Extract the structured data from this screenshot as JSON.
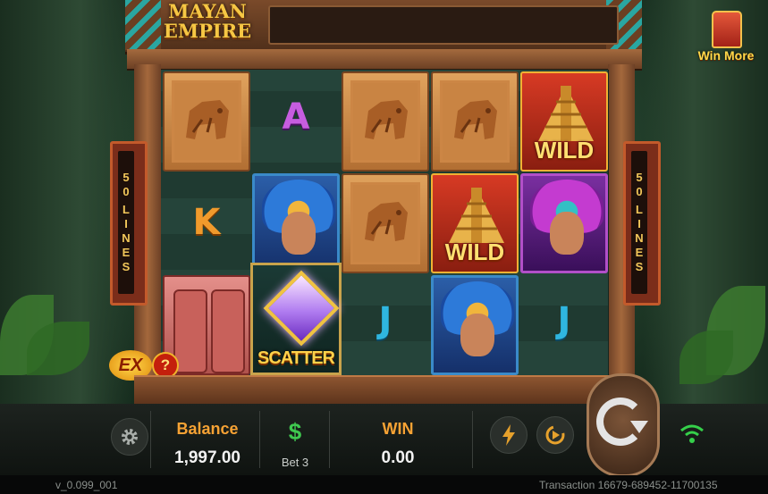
{
  "game": {
    "logo_line1": "MAYAN",
    "logo_line2": "EMPIRE",
    "win_more_label": "Win More"
  },
  "paylines": {
    "left_label": [
      "5",
      "0",
      "L",
      "I",
      "N",
      "E",
      "S"
    ],
    "right_label": [
      "5",
      "0",
      "L",
      "I",
      "N",
      "E",
      "S"
    ]
  },
  "reels": [
    [
      "jaguar-stone",
      "letter-k",
      "totem-stone"
    ],
    [
      "letter-a",
      "warrior",
      "scatter"
    ],
    [
      "jaguar-stone",
      "jaguar-stone",
      "letter-j"
    ],
    [
      "jaguar-stone",
      "wild",
      "warrior"
    ],
    [
      "wild",
      "priestess",
      "letter-j"
    ]
  ],
  "symbols": {
    "letter_a": "A",
    "letter_k": "K",
    "letter_j": "J",
    "wild": "WILD",
    "scatter": "SCATTER"
  },
  "extra_bet": {
    "label": "EX",
    "help": "?"
  },
  "hud": {
    "balance_label": "Balance",
    "balance_value": "1,997.00",
    "bet_icon": "$",
    "bet_label": "Bet 3",
    "win_label": "WIN",
    "win_value": "0.00"
  },
  "icons": {
    "settings": "gear-icon",
    "turbo": "lightning-icon",
    "autoplay": "autoplay-icon",
    "spin": "spin-icon",
    "signal": "wifi-icon",
    "chest": "treasure-chest-icon"
  },
  "footer": {
    "version": "v_0.099_001",
    "transaction": "Transaction 16679-689452-11700135"
  },
  "colors": {
    "gold_text": "#f6a234",
    "win_text": "#f6a234",
    "white_text": "#f2f2f2",
    "signal": "#35d04a"
  }
}
